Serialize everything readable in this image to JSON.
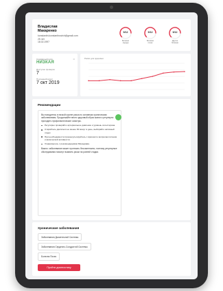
{
  "profile": {
    "name_line1": "Владислав",
    "name_line2": "Макаренко",
    "email": "konstantin.konstantinovich@gmail.com",
    "age": "25 лет",
    "extra": "18.02.1997"
  },
  "gauges": [
    {
      "value": "9/12",
      "label_line1": "Болезни",
      "label_line2": "сердца",
      "fraction": 0.75
    },
    {
      "value": "9/12",
      "label_line1": "Болезни",
      "label_line2": "почек",
      "fraction": 0.75
    },
    {
      "value": "9/12",
      "label_line1": "Другие",
      "label_line2": "болезни",
      "fraction": 0.75
    }
  ],
  "stats": {
    "risk_label": "Суммарный риск",
    "risk_value": "НИЗКАЯ",
    "checks_label": "Доступно проверок",
    "checks_value": "7",
    "last_label": "Последний визит",
    "last_value": "7 окт 2019"
  },
  "chart_data": {
    "type": "line",
    "title": "Риски для здоровья",
    "series": [
      {
        "values": [
          4,
          4,
          4.5,
          4,
          4,
          5,
          6,
          7.5,
          8,
          8.2
        ]
      }
    ],
    "ylim": [
      0,
      12
    ],
    "grid": true,
    "color": "#e2344a"
  },
  "recommendations": {
    "title": "Рекомендации",
    "intro": "Вы находитесь в низкой группе риска по основным хроническим заболеваниям. Продолжайте вести здоровый образ жизни и регулярно проходить профилактические осмотры.",
    "bullets": [
      "Регулярно проверяйте артериальное давление и уровень холестерина.",
      "Старайтесь двигаться не менее 30 минут в день, выбирайте активный отдых.",
      "При необходимости проконсультируйтесь с врачом по вопросам питания и физической активности.",
      "Ознакомьтесь с рекомендациями Минздрава."
    ],
    "footer": "Важно: заболевание может протекать бессимптомно, поэтому регулярные обследования помогут выявить риски на ранней стадии."
  },
  "chronic": {
    "title": "Хронические заболевания",
    "items": [
      "Заболевания Дыхательной Системы",
      "Заболевания Сердечно-Сосудистой Системы",
      "Болезни Почек"
    ]
  },
  "cta": {
    "label": "Пройти диагностику"
  },
  "colors": {
    "accent": "#e2344a",
    "risk_low": "#4ca85a",
    "status_dot": "#5cc55f"
  }
}
